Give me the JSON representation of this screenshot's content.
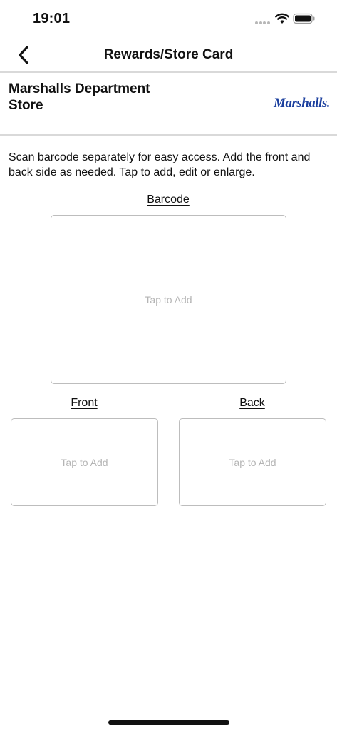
{
  "status_bar": {
    "time": "19:01",
    "icons": [
      "signal-dots-icon",
      "wifi-icon",
      "battery-icon"
    ]
  },
  "nav": {
    "title": "Rewards/Store Card",
    "back_icon": "chevron-left-icon"
  },
  "store": {
    "name": "Marshalls Department Store",
    "logo_text": "Marshalls.",
    "logo_color": "#1b3f9e"
  },
  "instructions": "Scan barcode separately for easy access. Add the front and back side as needed. Tap to add, edit or enlarge.",
  "barcode": {
    "label": "Barcode",
    "placeholder": "Tap to Add"
  },
  "front": {
    "label": "Front",
    "placeholder": "Tap to Add"
  },
  "back": {
    "label": "Back",
    "placeholder": "Tap to Add"
  }
}
